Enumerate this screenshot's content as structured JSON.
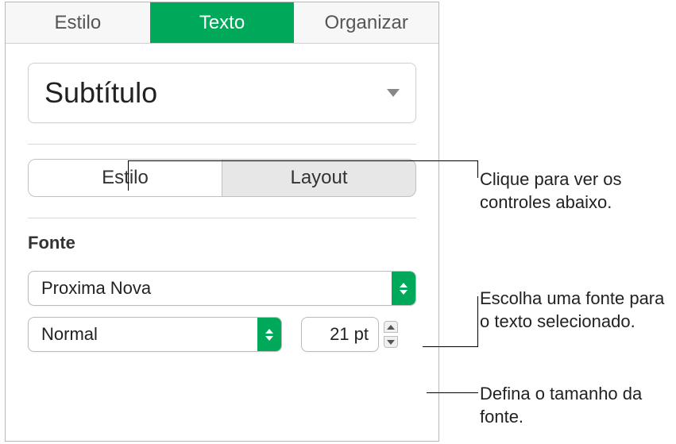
{
  "tabs": {
    "style": "Estilo",
    "text": "Texto",
    "arrange": "Organizar"
  },
  "paragraph_style": {
    "selected": "Subtítulo"
  },
  "subtabs": {
    "style": "Estilo",
    "layout": "Layout"
  },
  "font": {
    "section_label": "Fonte",
    "family": "Proxima Nova",
    "style": "Normal",
    "size": "21 pt"
  },
  "callouts": {
    "c1": "Clique para ver os controles abaixo.",
    "c2": "Escolha uma fonte para o texto selecionado.",
    "c3": "Defina o tamanho da fonte."
  }
}
